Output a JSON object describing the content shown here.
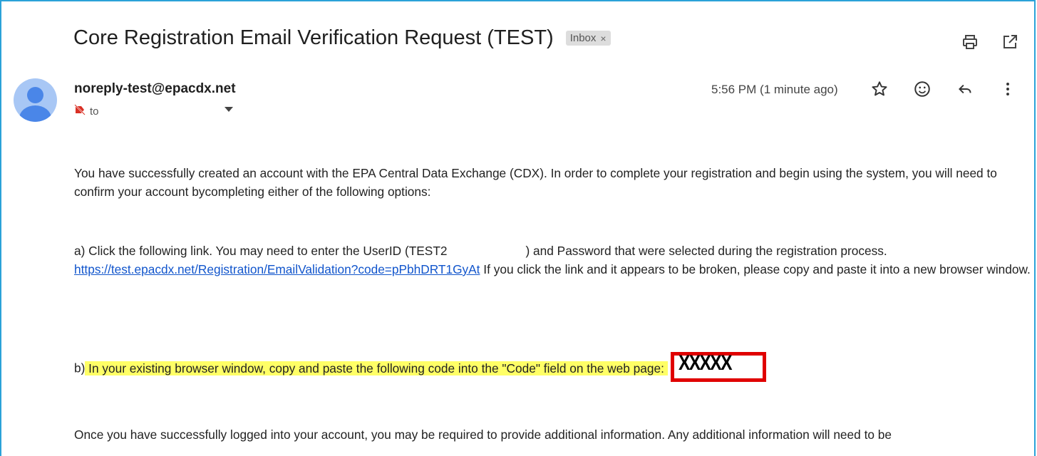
{
  "email": {
    "subject": "Core Registration Email Verification Request (TEST)",
    "label_chip": "Inbox",
    "label_chip_close": "×",
    "sender": "noreply-test@epacdx.net",
    "to_prefix": "to",
    "timestamp": "5:56 PM (1 minute ago)"
  },
  "icons": {
    "print": "print-icon",
    "open_new_window": "open-in-new-window-icon",
    "star": "star-icon",
    "emoji": "emoji-reaction-icon",
    "reply": "reply-icon",
    "more": "more-options-icon",
    "label_off": "label-off-icon",
    "dropdown": "chevron-down-icon"
  },
  "body": {
    "p1": "You have successfully created an account with the EPA Central Data Exchange (CDX). In order to complete your registration and begin using the system, you will need to confirm your account bycompleting either of the following options:",
    "p2_before_gap": "a) Click the following link. You may need to enter the UserID (TEST2",
    "p2_after_gap": ") and Password that were selected during the registration process.",
    "link": "https://test.epacdx.net/Registration/EmailValidation?code=pPbhDRT1GyAt",
    "p2_after_link": " If you click the link and it appears to be broken, please copy and paste it into a new browser window.",
    "p3_prefix": "b)",
    "p3_highlighted": " In your existing browser window, copy and paste the following code into the \"Code\" field on the web page: ",
    "code": "XXXXX",
    "p4": "Once you have successfully logged into your account, you may be required to provide additional information. Any additional information will need to be"
  },
  "colors": {
    "frame_border": "#2aa2d8",
    "link": "#1155cc",
    "highlight": "#ffff66",
    "code_box_border": "#e00000",
    "avatar_bg": "#a8c7f5",
    "avatar_fg": "#4a86e8"
  }
}
